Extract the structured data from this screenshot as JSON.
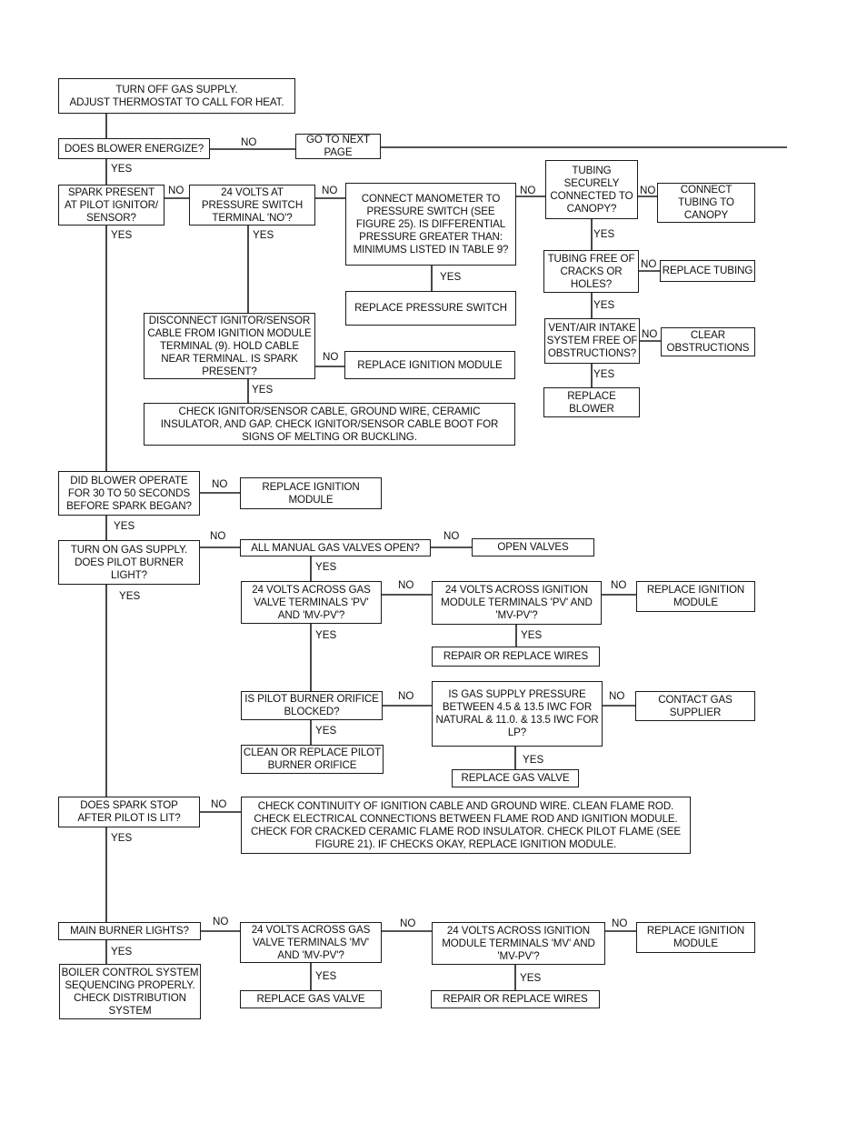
{
  "diagram": {
    "type": "troubleshooting-flowchart",
    "line_color": "#1a1a1a",
    "nodes": {
      "start": "TURN OFF GAS SUPPLY.\nADJUST THERMOSTAT TO CALL FOR HEAT.",
      "blower_energize": "DOES BLOWER ENERGIZE?",
      "next_page": "GO TO NEXT\nPAGE",
      "spark_present": "SPARK PRESENT\nAT PILOT IGNITOR/\nSENSOR?",
      "volts_pressure_switch": "24 VOLTS AT\nPRESSURE SWITCH\nTERMINAL 'NO'?",
      "manometer": "CONNECT MANOMETER TO\nPRESSURE SWITCH (SEE\nFIGURE 25). IS DIFFERENTIAL\nPRESSURE GREATER THAN:\nMINIMUMS LISTED IN TABLE 9?",
      "tubing_connected": "TUBING\nSECURELY\nCONNECTED TO\nCANOPY?",
      "connect_tubing": "CONNECT\nTUBING TO\nCANOPY",
      "tubing_free": "TUBING FREE OF\nCRACKS OR\nHOLES?",
      "replace_tubing": "REPLACE TUBING",
      "vent_free": "VENT/AIR INTAKE\nSYSTEM FREE OF\nOBSTRUCTIONS?",
      "clear_obstructions": "CLEAR\nOBSTRUCTIONS",
      "replace_blower": "REPLACE\nBLOWER",
      "replace_pressure_switch": "REPLACE PRESSURE SWITCH",
      "disconnect_ignitor": "DISCONNECT IGNITOR/SENSOR\nCABLE FROM IGNITION MODULE\nTERMINAL (9). HOLD CABLE\nNEAR TERMINAL. IS SPARK\nPRESENT?",
      "replace_ignition_module_1": "REPLACE IGNITION MODULE",
      "check_ignitor_cable": "CHECK IGNITOR/SENSOR CABLE, GROUND WIRE, CERAMIC\nINSULATOR, AND GAP. CHECK IGNITOR/SENSOR CABLE BOOT FOR\nSIGNS OF MELTING OR BUCKLING.",
      "blower_30_50": "DID BLOWER OPERATE\nFOR 30 TO 50 SECONDS\nBEFORE SPARK BEGAN?",
      "replace_ignition_module_2": "REPLACE IGNITION\nMODULE",
      "turn_on_gas": "TURN ON GAS SUPPLY.\nDOES PILOT BURNER\nLIGHT?",
      "manual_valves_open": "ALL MANUAL GAS VALVES OPEN?",
      "open_valves": "OPEN VALVES",
      "volts_gas_valve_pv": "24 VOLTS ACROSS GAS\nVALVE TERMINALS 'PV'\nAND 'MV-PV'?",
      "volts_module_pv": "24 VOLTS ACROSS IGNITION\nMODULE TERMINALS 'PV' AND\n'MV-PV'?",
      "replace_ignition_module_3": "REPLACE IGNITION\nMODULE",
      "repair_wires_1": "REPAIR OR REPLACE WIRES",
      "pilot_orifice_blocked": "IS PILOT BURNER ORIFICE\nBLOCKED?",
      "gas_supply_pressure": "IS GAS SUPPLY PRESSURE\nBETWEEN 4.5 & 13.5 IWC FOR\nNATURAL & 11.0. & 13.5 IWC FOR\nLP?",
      "contact_gas_supplier": "CONTACT GAS\nSUPPLIER",
      "clean_orifice": "CLEAN OR REPLACE PILOT\nBURNER ORIFICE",
      "replace_gas_valve_1": "REPLACE GAS VALVE",
      "spark_stop": "DOES SPARK STOP\nAFTER PILOT IS LIT?",
      "check_continuity": "CHECK CONTINUITY OF IGNITION CABLE AND GROUND WIRE. CLEAN FLAME ROD.\nCHECK ELECTRICAL CONNECTIONS BETWEEN FLAME ROD AND IGNITION MODULE.\nCHECK FOR CRACKED CERAMIC FLAME ROD INSULATOR. CHECK PILOT FLAME (SEE\nFIGURE 21). IF CHECKS OKAY, REPLACE IGNITION MODULE.",
      "main_burner_lights": "MAIN BURNER LIGHTS?",
      "boiler_sequencing": "BOILER CONTROL SYSTEM\nSEQUENCING PROPERLY.\nCHECK DISTRIBUTION\nSYSTEM",
      "volts_gas_valve_mv": "24 VOLTS ACROSS GAS\nVALVE TERMINALS 'MV'\nAND 'MV-PV'?",
      "replace_gas_valve_2": "REPLACE GAS VALVE",
      "volts_module_mv": "24 VOLTS ACROSS IGNITION\nMODULE TERMINALS 'MV' AND\n'MV-PV'?",
      "replace_ignition_module_4": "REPLACE IGNITION\nMODULE",
      "repair_wires_2": "REPAIR OR REPLACE WIRES"
    },
    "labels": {
      "yes": "YES",
      "no": "NO"
    }
  }
}
